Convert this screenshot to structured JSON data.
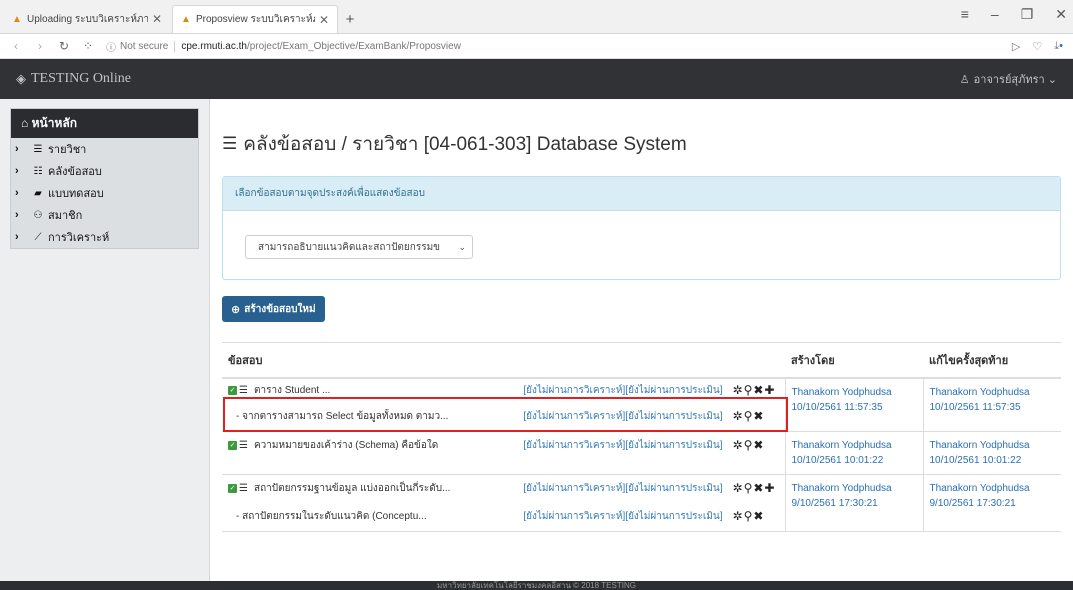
{
  "browser": {
    "tabs": [
      {
        "title": "Uploading ระบบวิเคราะห์ภาย"
      },
      {
        "title": "Proposview ระบบวิเคราะห์ภาย"
      }
    ],
    "new_tab": "+",
    "address": {
      "security": "Not secure",
      "host": "cpe.rmuti.ac.th",
      "path": "/project/Exam_Objective/ExamBank/Proposview"
    }
  },
  "app": {
    "brand": "TESTING Online",
    "user": "อาจารย์สุภัทรา"
  },
  "sidebar": {
    "header": "หน้าหลัก",
    "items": [
      {
        "label": "รายวิชา",
        "icon": "list-icon"
      },
      {
        "label": "คลังข้อสอบ",
        "icon": "database-icon"
      },
      {
        "label": "แบบทดสอบ",
        "icon": "book-icon"
      },
      {
        "label": "สมาชิก",
        "icon": "users-icon"
      },
      {
        "label": "การวิเคราะห์",
        "icon": "chart-icon"
      }
    ]
  },
  "main": {
    "title": "คลังข้อสอบ / รายวิชา [04-061-303] Database System",
    "panel_heading": "เลือกข้อสอบตามจุดประสงค์เพื่อแสดงข้อสอบ",
    "objective_selected": "สามารถอธิบายแนวคิดและสถาปัตยกรรมข",
    "new_button": "สร้างข้อสอบใหม่",
    "table": {
      "headers": [
        "ข้อสอบ",
        "สร้างโดย",
        "แก้ไขครั้งสุดท้าย"
      ],
      "rows": [
        {
          "question": "ตาราง Student  ...",
          "status": "[ยังไม่ผ่านการวิเคราะห์][ยังไม่ผ่านการประเมิน]",
          "sub": "- จากตารางสามารถ Select ข้อมูลทั้งหมด ตามว...",
          "sub_status": "[ยังไม่ผ่านการวิเคราะห์][ยังไม่ผ่านการประเมิน]",
          "created_by": "Thanakorn Yodphudsa",
          "created_at": "10/10/2561 11:57:35",
          "edited_by": "Thanakorn Yodphudsa",
          "edited_at": "10/10/2561 11:57:35"
        },
        {
          "question": "ความหมายของเค้าร่าง (Schema) คือข้อใด",
          "status": "[ยังไม่ผ่านการวิเคราะห์][ยังไม่ผ่านการประเมิน]",
          "created_by": "Thanakorn Yodphudsa",
          "created_at": "10/10/2561 10:01:22",
          "edited_by": "Thanakorn Yodphudsa",
          "edited_at": "10/10/2561 10:01:22"
        },
        {
          "question": "สถาปัตยกรรมฐานข้อมูล แบ่งออกเป็นกี่ระดับ...",
          "status": "[ยังไม่ผ่านการวิเคราะห์][ยังไม่ผ่านการประเมิน]",
          "sub": "- สถาปัตยกรรมในระดับแนวคิด  (Conceptu...",
          "sub_status": "[ยังไม่ผ่านการวิเคราะห์][ยังไม่ผ่านการประเมิน]",
          "created_by": "Thanakorn Yodphudsa",
          "created_at": "9/10/2561 17:30:21",
          "edited_by": "Thanakorn Yodphudsa",
          "edited_at": "9/10/2561 17:30:21"
        }
      ]
    }
  },
  "footer": "มหาวิทยาลัยเทคโนโลยีราชมงคลอีสาน © 2018 TESTING"
}
